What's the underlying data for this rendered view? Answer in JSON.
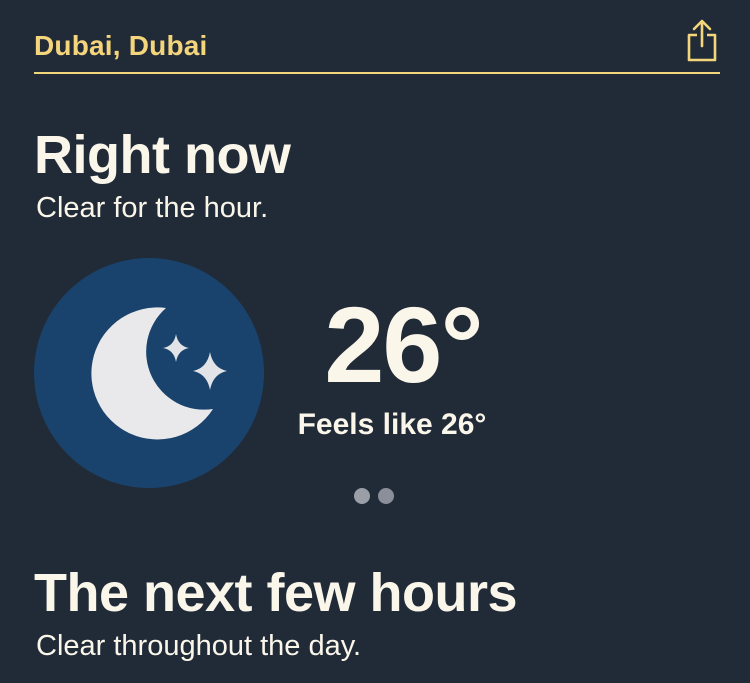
{
  "header": {
    "location": "Dubai, Dubai",
    "share_icon": "share-icon"
  },
  "now": {
    "title": "Right now",
    "subtitle": "Clear for the hour.",
    "icon": "clear-night-moon-icon",
    "temperature": "26°",
    "feels_like": "Feels like 26°"
  },
  "pager": {
    "pages": 2,
    "active_index": 0
  },
  "next": {
    "title": "The next few hours",
    "subtitle": "Clear throughout the day."
  },
  "colors": {
    "background": "#212b38",
    "accent": "#f5d57c",
    "icon_circle": "#19436d",
    "text": "#fbf6ea"
  }
}
